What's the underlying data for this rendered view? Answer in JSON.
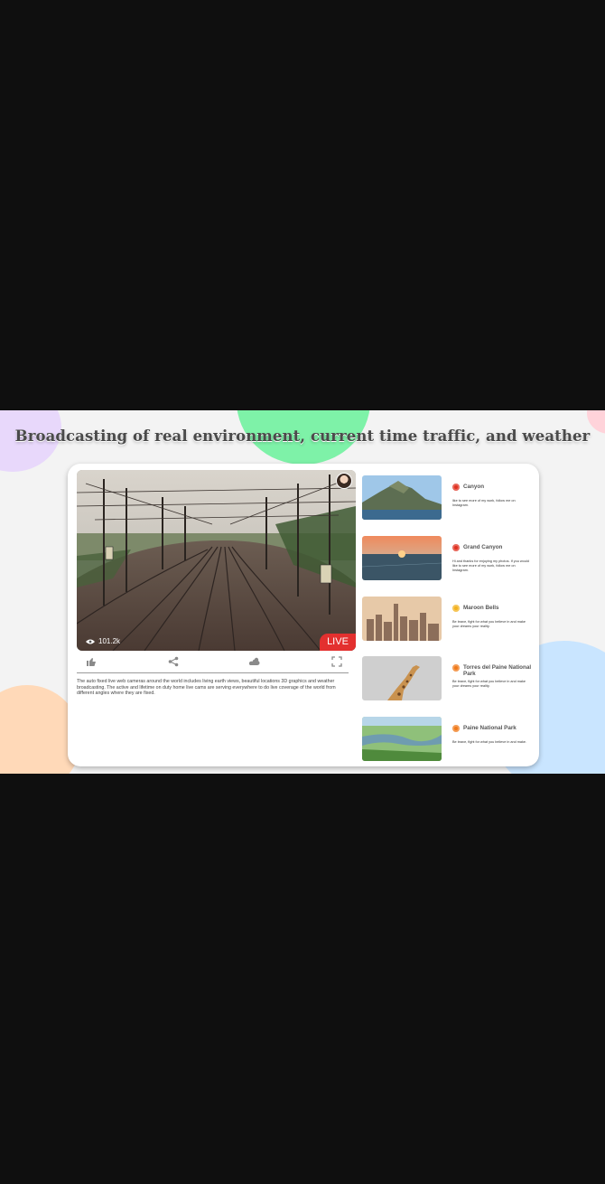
{
  "headline": "Broadcasting of real environment, current time traffic, and weather",
  "player": {
    "stream_title": "",
    "stream_subtitle": "",
    "views": "101.2k",
    "live_label": "LIVE"
  },
  "controls": [
    "thumbs-up-icon",
    "share-icon",
    "weather-icon",
    "fullscreen-icon"
  ],
  "description": "The auto fixed live web cameras around the world includes living earth views, beautiful locations 3D graphics and weather broadcasting. The active and lifetime on duty home live cams are serving everywhere to do live coverage of the world from different angles where they are fixed.",
  "list": [
    {
      "title": "Canyon",
      "text": "like to see more of my work, follow me on Instagram.",
      "icon": "red-pin-icon",
      "thumb": "coast"
    },
    {
      "title": "Grand Canyon",
      "text": "Hi and thanks for enjoying my photos. If you would like to see more of my work, follow me on Instagram.",
      "icon": "red-pin-icon",
      "thumb": "sunset-sea"
    },
    {
      "title": "Maroon Bells",
      "text": "Be brave, fight for what you believe in and make your dreams your reality.",
      "icon": "yellow-pin-icon",
      "thumb": "city"
    },
    {
      "title": "Torres del Paine National Park",
      "text": "Be brave, fight for what you believe in and make your dreams your reality.",
      "icon": "orange-pin-icon",
      "thumb": "giraffe"
    },
    {
      "title": "Paine National Park",
      "text": "Be brave, fight for what you believe in and make.",
      "icon": "orange-pin-icon",
      "thumb": "river"
    }
  ],
  "colors": {
    "page_bg": "#0f0f0f",
    "banner_bg": "#f3f3f3",
    "live_red": "#e3302f",
    "card_bg": "#ffffff"
  }
}
